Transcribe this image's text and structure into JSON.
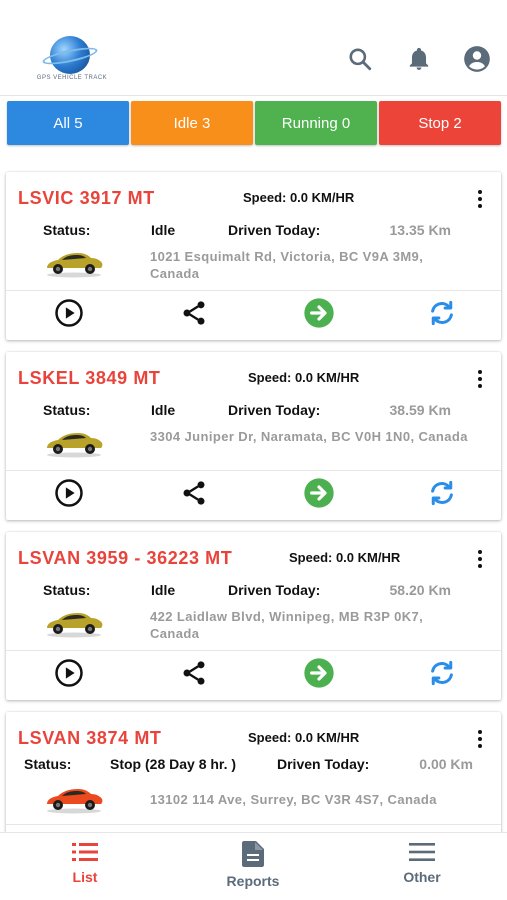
{
  "header": {
    "logo_text": "GPS VEHICLE TRACK",
    "icons": [
      "search-icon",
      "bell-icon",
      "account-icon"
    ]
  },
  "filters": [
    {
      "label": "All 5",
      "color": "#2d88e0"
    },
    {
      "label": "Idle 3",
      "color": "#f88f1a"
    },
    {
      "label": "Running 0",
      "color": "#4fb24f"
    },
    {
      "label": "Stop 2",
      "color": "#ec4438"
    }
  ],
  "vehicles": [
    {
      "plate": "LSVIC 3917 MT",
      "speed": "Speed: 0.0 KM/HR",
      "status_label": "Status:",
      "status": "Idle",
      "driven_label": "Driven Today:",
      "driven": "13.35 Km",
      "address": "1021 Esquimalt Rd, Victoria, BC V9A 3M9, Canada",
      "car_color": "#b8a22a"
    },
    {
      "plate": "LSKEL 3849 MT",
      "speed": "Speed: 0.0 KM/HR",
      "status_label": "Status:",
      "status": "Idle",
      "driven_label": "Driven Today:",
      "driven": "38.59 Km",
      "address": "3304 Juniper Dr, Naramata, BC V0H 1N0, Canada",
      "car_color": "#b8a22a"
    },
    {
      "plate": "LSVAN 3959 - 36223 MT",
      "speed": "Speed: 0.0 KM/HR",
      "status_label": "Status:",
      "status": "Idle",
      "driven_label": "Driven Today:",
      "driven": "58.20 Km",
      "address": "422 Laidlaw Blvd, Winnipeg, MB R3P 0K7, Canada",
      "car_color": "#b8a22a"
    },
    {
      "plate": "LSVAN 3874 MT",
      "speed": "Speed: 0.0 KM/HR",
      "status_label": "Status:",
      "status": "Stop (28 Day 8 hr. )",
      "driven_label": "Driven Today:",
      "driven": "0.00 Km",
      "address": "13102 114 Ave, Surrey, BC V3R 4S7, Canada",
      "car_color": "#ec4a1e"
    }
  ],
  "actions": [
    "play-icon",
    "share-icon",
    "arrow-right-circle-icon",
    "refresh-icon"
  ],
  "action_colors": {
    "play": "#111111",
    "share": "#111111",
    "navigate": "#4caf50",
    "refresh": "#2a8ee8"
  },
  "bottom_nav": [
    {
      "label": "List",
      "icon": "list-icon",
      "active": true,
      "color": "#e8443b"
    },
    {
      "label": "Reports",
      "icon": "reports-icon",
      "active": false,
      "color": "#5b6b7a"
    },
    {
      "label": "Other",
      "icon": "menu-icon",
      "active": false,
      "color": "#5b6b7a"
    }
  ]
}
